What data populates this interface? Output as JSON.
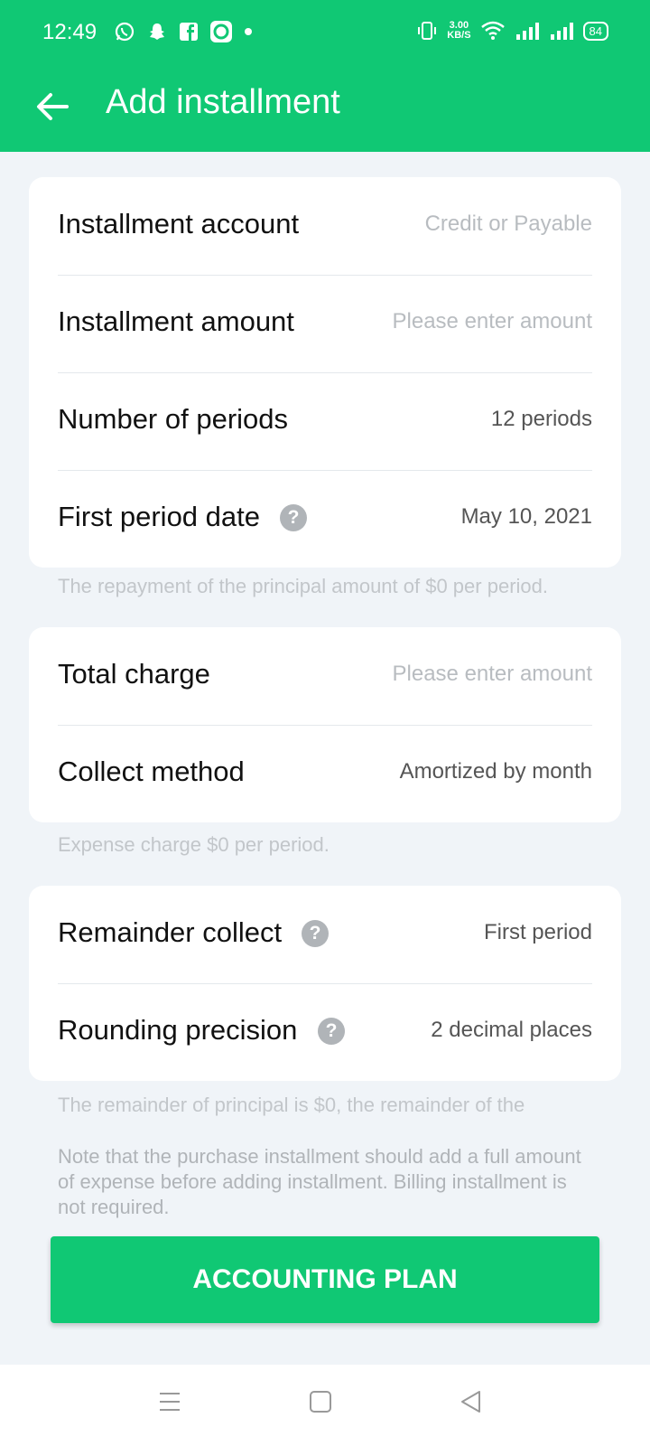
{
  "status_bar": {
    "time": "12:49",
    "speed_value": "3.00",
    "speed_unit": "KB/S",
    "battery": "84",
    "left_icons": [
      "whatsapp-icon",
      "snapchat-icon",
      "facebook-icon",
      "app-notification-icon",
      "dot-icon"
    ],
    "right_icons": [
      "vibrate-icon",
      "wifi-icon",
      "signal-icon",
      "signal-icon",
      "battery-icon"
    ]
  },
  "app_bar": {
    "title": "Add installment",
    "back_icon": "arrow-left-icon"
  },
  "card1": {
    "rows": [
      {
        "label": "Installment account",
        "value": "Credit or Payable"
      },
      {
        "label": "Installment amount",
        "value": "Please enter amount"
      },
      {
        "label": "Number of periods",
        "value": "12 periods"
      },
      {
        "label": "First period date",
        "value": "May 10, 2021"
      }
    ],
    "note": "The repayment of the principal amount of $0 per period."
  },
  "card2": {
    "rows": [
      {
        "label": "Total charge",
        "value": "Please enter amount"
      },
      {
        "label": "Collect method",
        "value": "Amortized by month"
      }
    ],
    "note": "Expense charge $0 per period."
  },
  "card3": {
    "rows": [
      {
        "label": "Remainder collect",
        "value": "First period"
      },
      {
        "label": "Rounding precision",
        "value": "2 decimal places"
      }
    ],
    "note": "The remainder of principal is $0, the remainder of the"
  },
  "footer_note": "Note that the purchase installment should add a full amount of expense before adding installment. Billing installment is not required.",
  "primary_button": "ACCOUNTING PLAN",
  "help_symbol": "?",
  "colors": {
    "accent": "#10c874",
    "background": "#f0f4f8",
    "placeholder": "#b8bcc0"
  },
  "nav_bar": {
    "icons": [
      "menu-icon",
      "home-square-icon",
      "back-triangle-icon"
    ]
  }
}
